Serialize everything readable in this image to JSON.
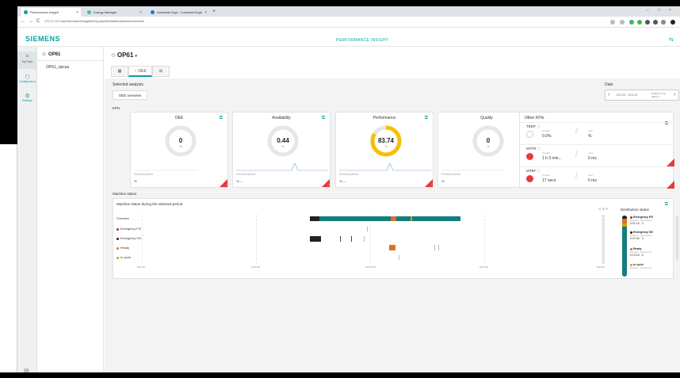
{
  "browser": {
    "tabs": [
      {
        "label": "Performance Insight",
        "color": "#0aa0a0"
      },
      {
        "label": "Energy Manager",
        "color": "#4db6ac"
      },
      {
        "label": "Industrial Edge - Industrial Edge",
        "color": "#1a73e8"
      }
    ],
    "url": "172.17.10.11/performanceinsight/#/my-plant/0/dashboard/oee/overview"
  },
  "app": {
    "logo": "SIEMENS",
    "title": "PERFORMANCE INSIGHT"
  },
  "rail": {
    "items": [
      {
        "label": "My Plant",
        "icon": "plant-icon"
      },
      {
        "label": "Configuration",
        "icon": "cube-icon"
      },
      {
        "label": "Settings",
        "icon": "gear-icon"
      }
    ]
  },
  "tree": {
    "root": "OP61",
    "child": "OP61_opcua"
  },
  "main": {
    "asset": "OP61",
    "tabs": [
      {
        "label": "",
        "icon": "grid-icon"
      },
      {
        "label": "OEE",
        "icon": "gauge-icon"
      },
      {
        "label": "",
        "icon": "hierarchy-icon"
      }
    ],
    "selected_analysis_label": "Selected analysis",
    "selected_analysis_value": "OEE overview",
    "date_label": "Date",
    "date_value": "8/21/22 - 8/21/22",
    "date_range": "Relative Time Offset 1",
    "kpis_label": "KPIs"
  },
  "kpis": [
    {
      "title": "OEE",
      "value": "0",
      "unit": "%",
      "prev": "Previous period",
      "pct": "%",
      "fraction": 0,
      "color": "#e6e6e6"
    },
    {
      "title": "Availability",
      "value": "0.44",
      "unit": "%",
      "prev": "Previous period",
      "pct": "% —",
      "fraction": 0.0044,
      "color": "#e6e6e6"
    },
    {
      "title": "Performance",
      "value": "83.74",
      "unit": "%",
      "prev": "Previous period",
      "pct": "% —",
      "fraction": 0.8374,
      "color": "#f5c000"
    },
    {
      "title": "Quality",
      "value": "0",
      "unit": "%",
      "prev": "Previous period",
      "pct": "%",
      "fraction": 0,
      "color": "#e6e6e6"
    }
  ],
  "other_kpis": {
    "title": "Other KPIs",
    "rows": [
      {
        "label": "TEEP",
        "cur_label": "Current",
        "cur_value": "0.0%",
        "last_label": "Last",
        "last_value": "%"
      },
      {
        "label": "MTTR",
        "cur_label": "Current",
        "cur_value": "1 h 3 min...",
        "last_label": "Last",
        "last_value": "0 ms"
      },
      {
        "label": "MTBF",
        "cur_label": "Current",
        "cur_value": "17 secs",
        "last_label": "Last",
        "last_value": "0 ms"
      }
    ]
  },
  "machine_status": {
    "section_label": "Machine status",
    "title": "Machine status during the selected period",
    "rows": [
      {
        "label": "Overview",
        "color": ""
      },
      {
        "label": "Emergency FIV",
        "color": "#c62828"
      },
      {
        "label": "Emergency SIV",
        "color": "#222222"
      },
      {
        "label": "Ready",
        "color": "#e07020"
      },
      {
        "label": "In cycle",
        "color": "#d4a000"
      }
    ],
    "axis": [
      "8/21/22",
      "6:00 AM",
      "12:00 PM",
      "6:00 PM",
      "8/22/22"
    ],
    "controls": "⊖ ⊕ ⟳",
    "distribution_title": "Distribution status",
    "distribution": [
      {
        "name": "Emergency FIV",
        "color": "#c62828",
        "dur_label": "Duration",
        "dur": "0:01:15",
        "occ_label": "Occurrence",
        "occ": "3"
      },
      {
        "name": "Emergency SIV",
        "color": "#222222",
        "dur_label": "Duration",
        "dur": "0:37:06",
        "occ_label": "Occurrence",
        "occ": "3"
      },
      {
        "name": "Ready",
        "color": "#e07020",
        "dur_label": "Duration",
        "dur": "0:19:18",
        "occ_label": "Occurrence",
        "occ": "8"
      },
      {
        "name": "In cycle",
        "color": "#d4a000",
        "dur_label": "Duration",
        "dur": "",
        "occ_label": "Occurrence",
        "occ": ""
      }
    ]
  }
}
